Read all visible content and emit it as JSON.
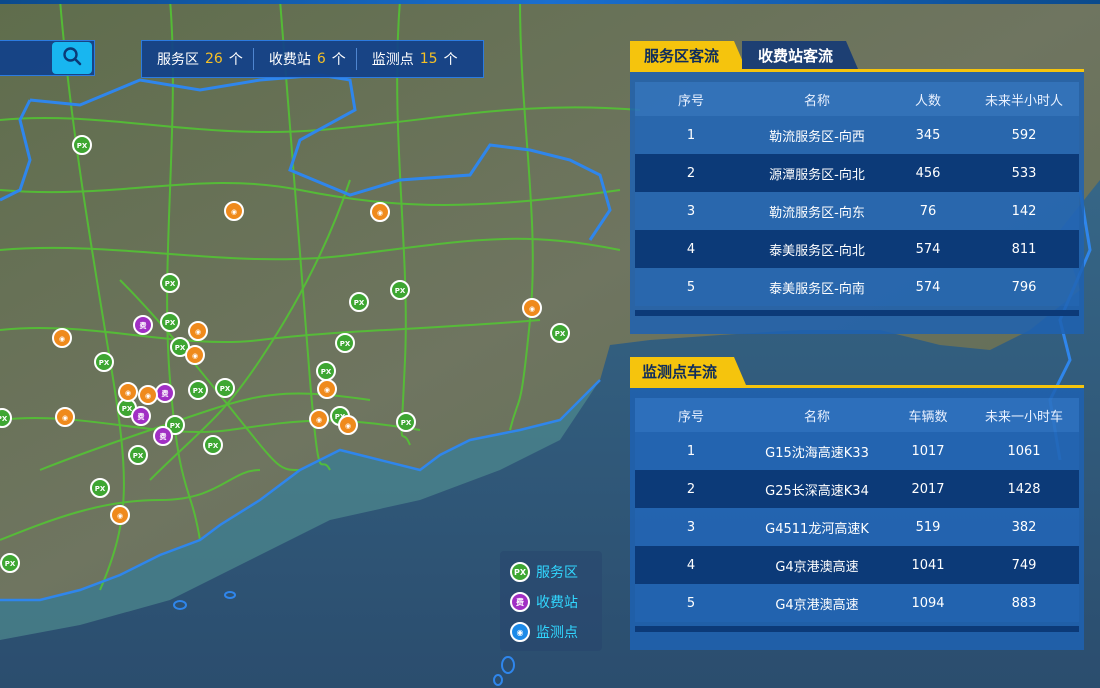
{
  "stats": [
    {
      "label": "服务区",
      "count": "26",
      "unit": "个"
    },
    {
      "label": "收费站",
      "count": "6",
      "unit": "个"
    },
    {
      "label": "监测点",
      "count": "15",
      "unit": "个"
    }
  ],
  "search": {
    "icon": "search-icon"
  },
  "panel_top": {
    "tabs": [
      "服务区客流",
      "收费站客流"
    ],
    "headers": [
      "序号",
      "名称",
      "人数",
      "未来半小时人"
    ],
    "rows": [
      [
        "1",
        "勒流服务区-向西",
        "345",
        "592"
      ],
      [
        "2",
        "源潭服务区-向北",
        "456",
        "533"
      ],
      [
        "3",
        "勒流服务区-向东",
        "76",
        "142"
      ],
      [
        "4",
        "泰美服务区-向北",
        "574",
        "811"
      ],
      [
        "5",
        "泰美服务区-向南",
        "574",
        "796"
      ]
    ]
  },
  "panel_bottom": {
    "tabs": [
      "监测点车流"
    ],
    "headers": [
      "序号",
      "名称",
      "车辆数",
      "未来一小时车"
    ],
    "rows": [
      [
        "1",
        "G15沈海高速K33",
        "1017",
        "1061"
      ],
      [
        "2",
        "G25长深高速K34",
        "2017",
        "1428"
      ],
      [
        "3",
        "G4511龙河高速K",
        "519",
        "382"
      ],
      [
        "4",
        "G4京港澳高速",
        "1041",
        "749"
      ],
      [
        "5",
        "G4京港澳高速",
        "1094",
        "883"
      ]
    ]
  },
  "legend": [
    {
      "label": "服务区",
      "icon": "service-area-icon",
      "color": "#3ea632",
      "glyph": "PX"
    },
    {
      "label": "收费站",
      "icon": "toll-station-icon",
      "color": "#a12fc4",
      "glyph": "费"
    },
    {
      "label": "监测点",
      "icon": "monitor-point-icon",
      "color": "#1c8ae8",
      "glyph": "◉"
    }
  ],
  "markers": {
    "service_area": [
      [
        82,
        145
      ],
      [
        170,
        283
      ],
      [
        170,
        322
      ],
      [
        180,
        347
      ],
      [
        104,
        362
      ],
      [
        198,
        390
      ],
      [
        225,
        388
      ],
      [
        127,
        408
      ],
      [
        175,
        425
      ],
      [
        213,
        445
      ],
      [
        138,
        455
      ],
      [
        100,
        488
      ],
      [
        10,
        563
      ],
      [
        400,
        290
      ],
      [
        359,
        302
      ],
      [
        345,
        343
      ],
      [
        326,
        371
      ],
      [
        340,
        416
      ],
      [
        406,
        422
      ],
      [
        560,
        333
      ],
      [
        2,
        418
      ]
    ],
    "toll_station": [
      [
        143,
        325
      ],
      [
        165,
        393
      ],
      [
        141,
        416
      ],
      [
        163,
        436
      ]
    ],
    "monitor_point": [
      [
        234,
        211
      ],
      [
        380,
        212
      ],
      [
        62,
        338
      ],
      [
        198,
        331
      ],
      [
        195,
        355
      ],
      [
        128,
        392
      ],
      [
        65,
        417
      ],
      [
        148,
        395
      ],
      [
        327,
        389
      ],
      [
        319,
        419
      ],
      [
        348,
        425
      ],
      [
        532,
        308
      ],
      [
        120,
        515
      ]
    ]
  },
  "colors": {
    "panel": "#1e62b2",
    "accent": "#f5c40d",
    "road": "#52c832",
    "boundary": "#2f86ec"
  }
}
